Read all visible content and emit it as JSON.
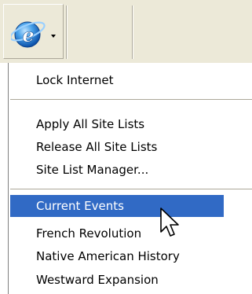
{
  "toolbar": {
    "button_icon": "internet-globe-icon",
    "dropdown_icon": "dropdown-arrow-icon"
  },
  "menu": {
    "items": [
      {
        "label": "Lock Internet"
      },
      {
        "label": "Apply All Site Lists"
      },
      {
        "label": "Release All Site Lists"
      },
      {
        "label": "Site List Manager..."
      },
      {
        "label": "Current Events",
        "selected": true
      },
      {
        "label": "French Revolution"
      },
      {
        "label": "Native American History"
      },
      {
        "label": "Westward Expansion"
      }
    ]
  },
  "colors": {
    "toolbar_bg": "#ece9d8",
    "selection_bg": "#316ac5",
    "selection_text": "#ffffff",
    "separator": "#aca899"
  },
  "cursor": {
    "icon": "mouse-pointer-icon"
  }
}
